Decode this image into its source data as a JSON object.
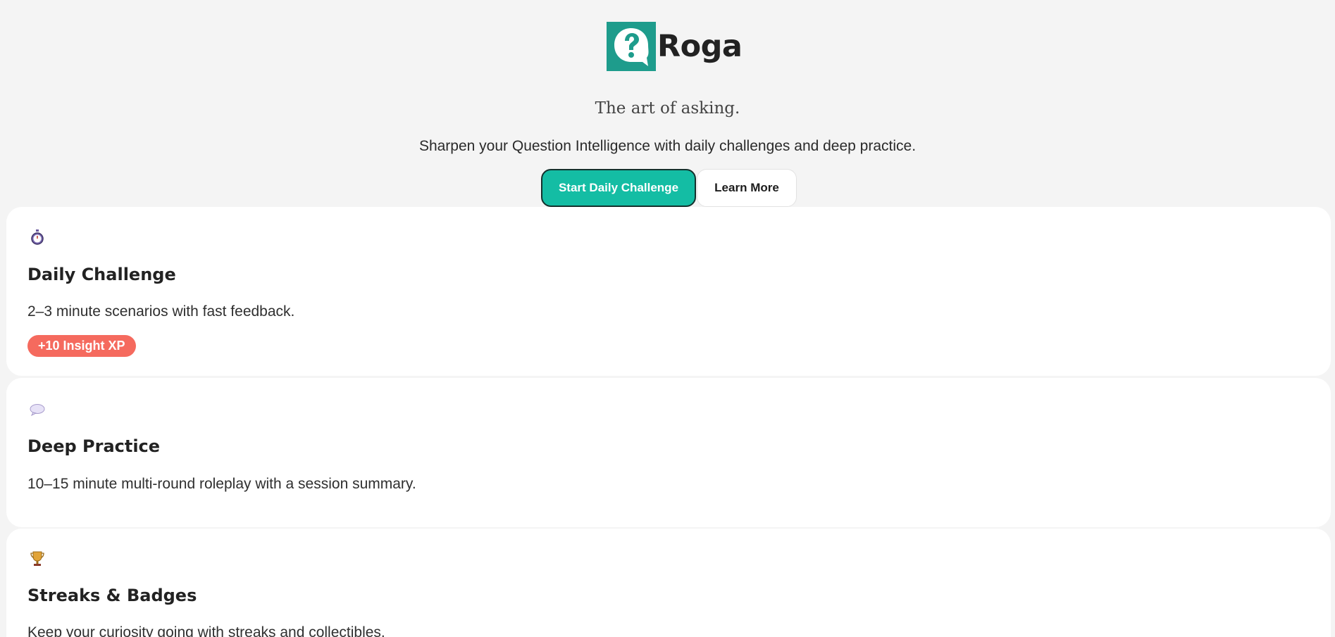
{
  "brand": {
    "name": "Roga",
    "logo_icon": "question-speech-bubble-icon",
    "accent_color": "#1e9c8c"
  },
  "hero": {
    "tagline": "The art of asking.",
    "subtitle": "Sharpen your Question Intelligence with daily challenges and deep practice.",
    "primary_button": "Start Daily Challenge",
    "secondary_button": "Learn More"
  },
  "features": [
    {
      "icon": "stopwatch-icon",
      "title": "Daily Challenge",
      "description": "2–3 minute scenarios with fast feedback.",
      "badge": "+10 Insight XP"
    },
    {
      "icon": "speech-balloon-icon",
      "title": "Deep Practice",
      "description": "10–15 minute multi-round roleplay with a session summary."
    },
    {
      "icon": "trophy-icon",
      "title": "Streaks & Badges",
      "description": "Keep your curiosity going with streaks and collectibles."
    }
  ],
  "colors": {
    "primary_button": "#14bda4",
    "badge": "#f56a5e",
    "background": "#f4f4f4"
  }
}
